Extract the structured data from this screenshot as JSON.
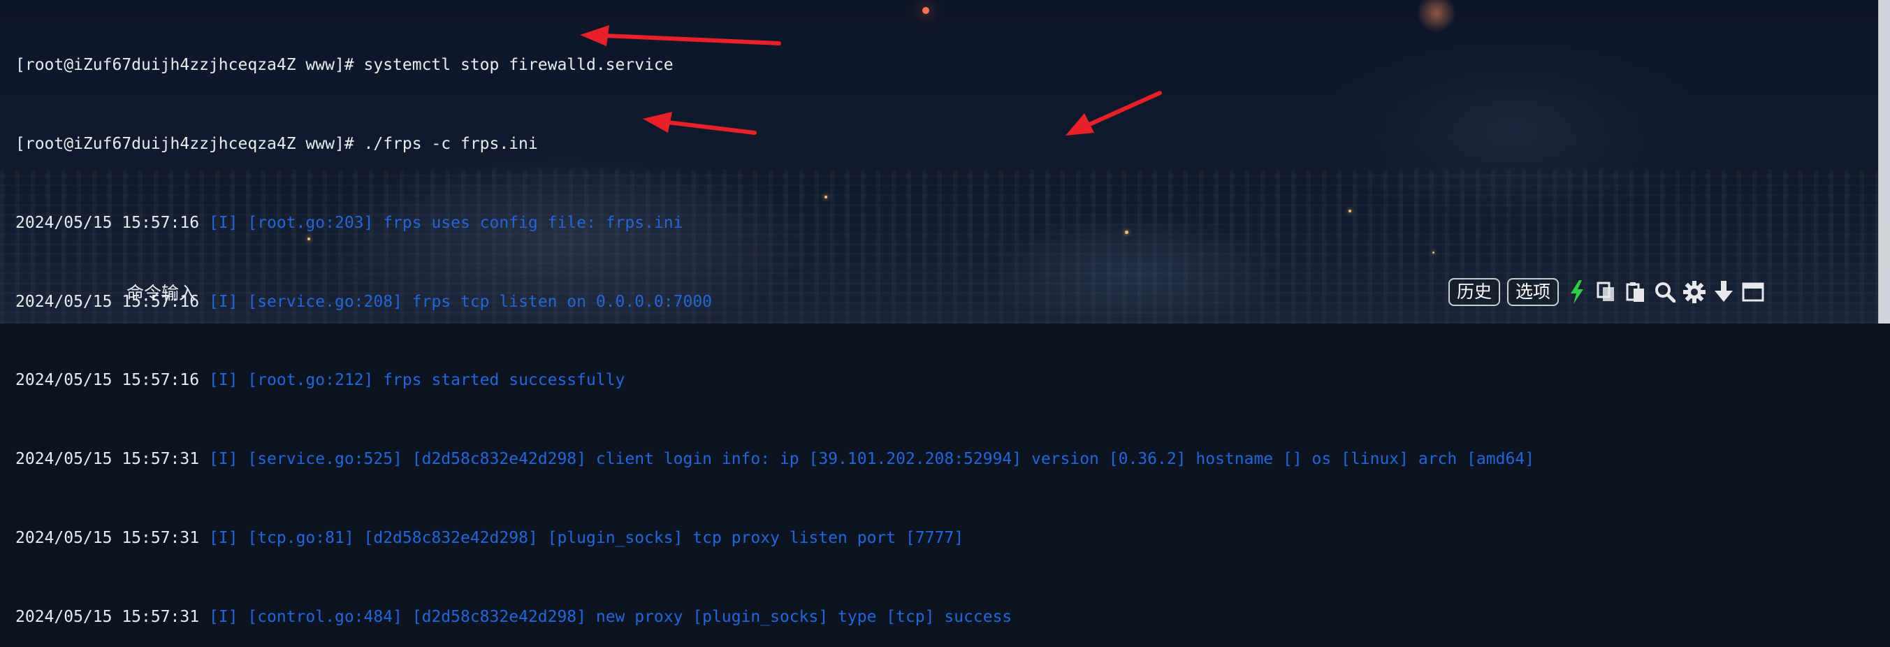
{
  "terminal": {
    "lines": [
      {
        "text": "[root@iZuf67duijh4zzjhceqza4Z www]# systemctl stop firewalld.service",
        "color": "white"
      },
      {
        "text": "[root@iZuf67duijh4zzjhceqza4Z www]# ./frps -c frps.ini",
        "color": "white"
      },
      {
        "timestamp": "2024/05/15 15:57:16",
        "text": " [I] [root.go:203] frps uses config file: frps.ini"
      },
      {
        "timestamp": "2024/05/15 15:57:16",
        "text": " [I] [service.go:208] frps tcp listen on 0.0.0.0:7000"
      },
      {
        "timestamp": "2024/05/15 15:57:16",
        "text": " [I] [root.go:212] frps started successfully"
      },
      {
        "timestamp": "2024/05/15 15:57:31",
        "text": " [I] [service.go:525] [d2d58c832e42d298] client login info: ip [39.101.202.208:52994] version [0.36.2] hostname [] os [linux] arch [amd64]"
      },
      {
        "timestamp": "2024/05/15 15:57:31",
        "text": " [I] [tcp.go:81] [d2d58c832e42d298] [plugin_socks] tcp proxy listen port [7777]"
      },
      {
        "timestamp": "2024/05/15 15:57:31",
        "text": " [I] [control.go:484] [d2d58c832e42d298] new proxy [plugin_socks] type [tcp] success"
      }
    ]
  },
  "command_input": {
    "label": "命令输入"
  },
  "toolbar": {
    "history_label": "历史",
    "options_label": "选项",
    "icons": [
      "lightning-icon",
      "copy-icon",
      "paste-icon",
      "search-icon",
      "gear-icon",
      "download-icon",
      "window-icon"
    ]
  },
  "colors": {
    "log_blue": "#2466d8",
    "prompt_white": "#e8ecf2",
    "arrow_red": "#e8202a",
    "accent_green": "#2ecc40"
  }
}
